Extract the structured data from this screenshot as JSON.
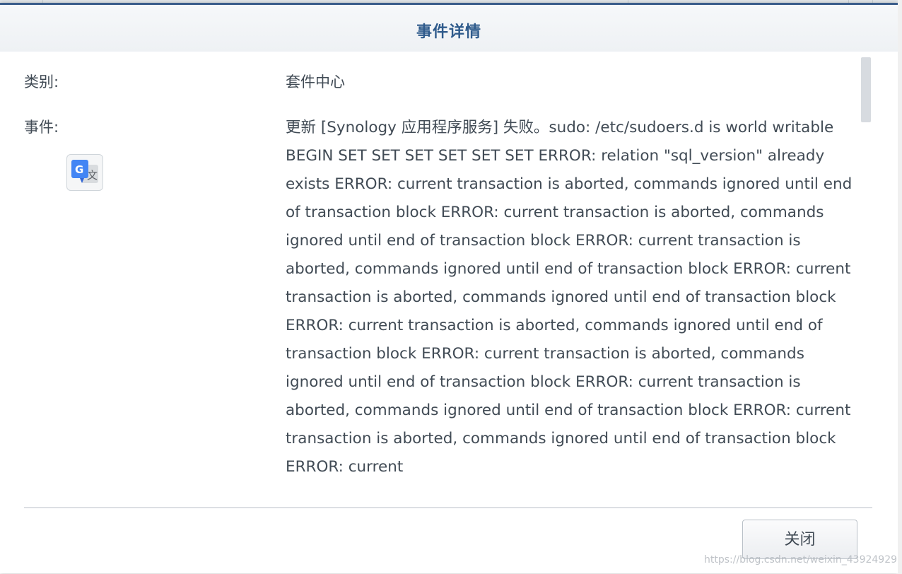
{
  "dialog": {
    "title": "事件详情",
    "close_label": "关闭"
  },
  "fields": {
    "category_label": "类别:",
    "category_value": "套件中心",
    "event_label": "事件:",
    "event_value": "更新 [Synology 应用程序服务] 失败。sudo: /etc/sudoers.d is world writable BEGIN SET SET SET SET SET SET ERROR: relation \"sql_version\" already exists ERROR: current transaction is aborted, commands ignored until end of transaction block ERROR: current transaction is aborted, commands ignored until end of transaction block ERROR: current transaction is aborted, commands ignored until end of transaction block ERROR: current transaction is aborted, commands ignored until end of transaction block ERROR: current transaction is aborted, commands ignored until end of transaction block ERROR: current transaction is aborted, commands ignored until end of transaction block ERROR: current transaction is aborted, commands ignored until end of transaction block ERROR: current transaction is aborted, commands ignored until end of transaction block ERROR: current"
  },
  "icons": {
    "translate": "google-translate-icon"
  },
  "watermark": "https://blog.csdn.net/weixin_43924929",
  "colors": {
    "title": "#2f5b8c",
    "accent_bar": "#3b5e8c",
    "text": "#414b55"
  }
}
